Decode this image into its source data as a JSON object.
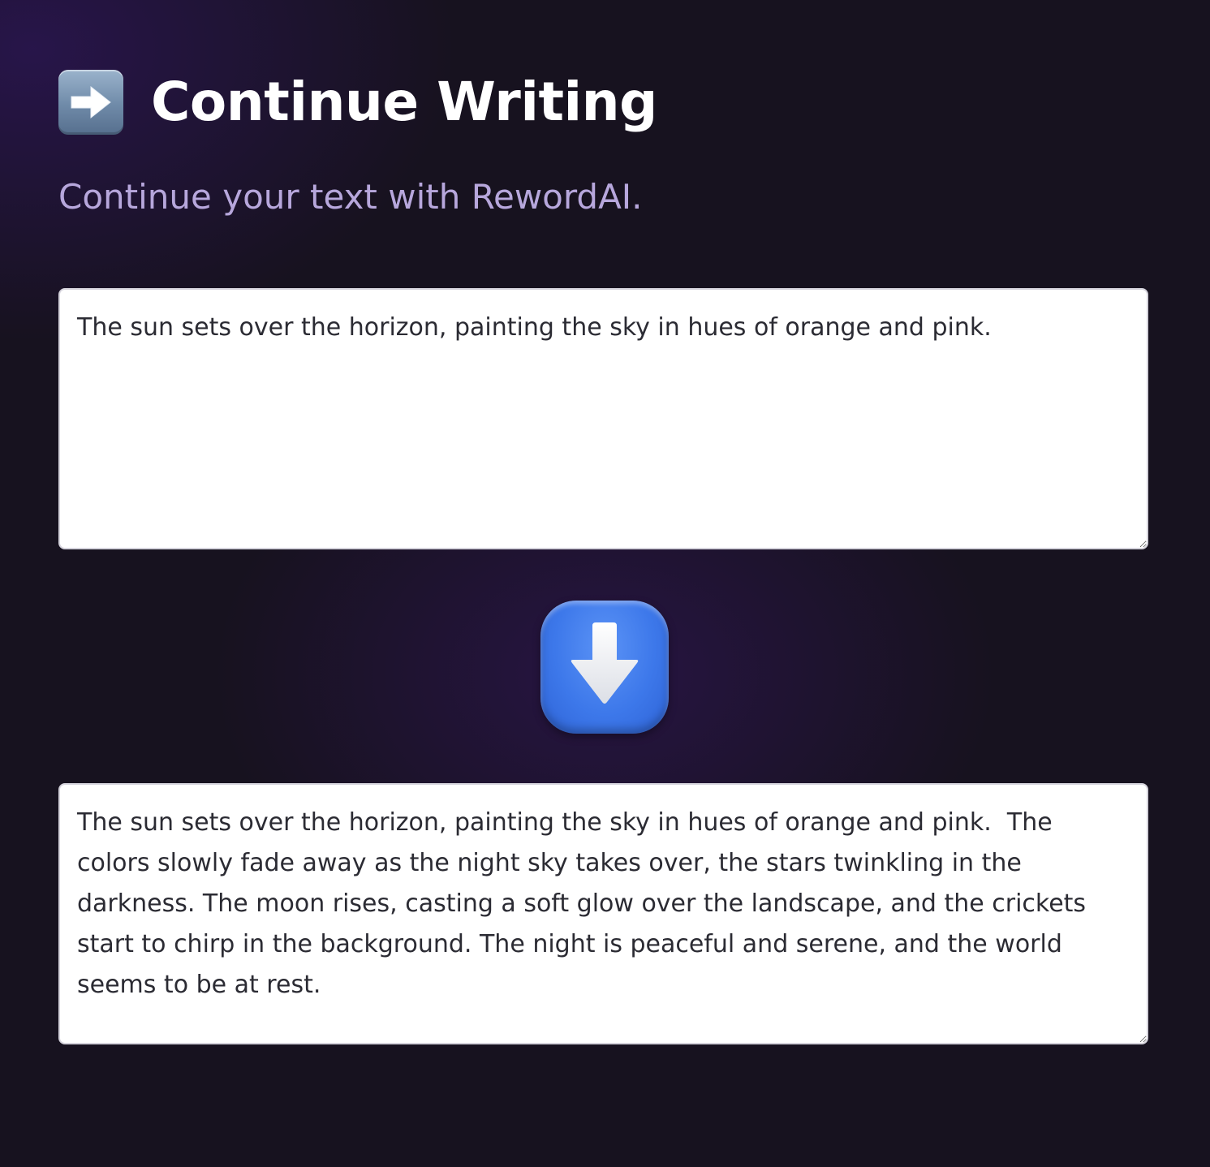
{
  "header": {
    "icon": "right-arrow-icon",
    "title": "Continue Writing",
    "subtitle": "Continue your text with RewordAI."
  },
  "input": {
    "value": "The sun sets over the horizon, painting the sky in hues of orange and pink."
  },
  "action": {
    "icon": "down-arrow-icon"
  },
  "output": {
    "value": "The sun sets over the horizon, painting the sky in hues of orange and pink.  The colors slowly fade away as the night sky takes over, the stars twinkling in the darkness. The moon rises, casting a soft glow over the landscape, and the crickets start to chirp in the background. The night is peaceful and serene, and the world seems to be at rest."
  },
  "colors": {
    "background": "#17121f",
    "title": "#ffffff",
    "subtitle": "#b7a7dc",
    "accent_blue": "#3d78ea"
  }
}
